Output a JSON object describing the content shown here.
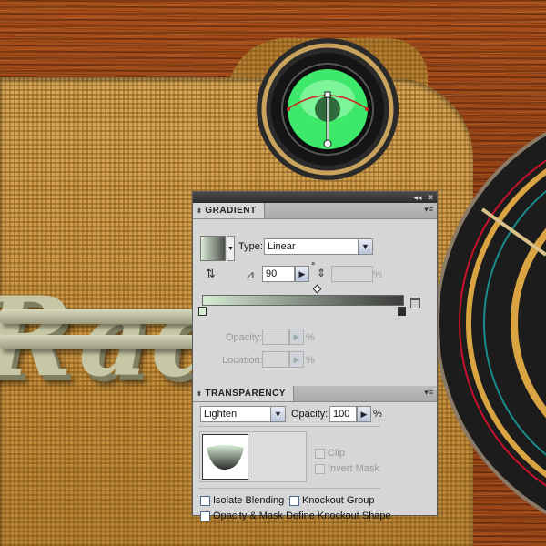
{
  "panels": {
    "dock_buttons": [
      "◂◂",
      "✕"
    ],
    "gradient": {
      "title": "GRADIENT",
      "type_label": "Type:",
      "type_value": "Linear",
      "angle_value": "90",
      "degree_symbol": "°",
      "aspect_unit": "%",
      "opacity_label": "Opacity:",
      "opacity_unit": "%",
      "location_label": "Location:",
      "location_unit": "%",
      "colors": {
        "start": "#d6ecd3",
        "end": "#2b2b2b"
      }
    },
    "transparency": {
      "title": "TRANSPARENCY",
      "blend_mode": "Lighten",
      "opacity_label": "Opacity:",
      "opacity_value": "100",
      "opacity_unit": "%",
      "clip_label": "Clip",
      "invert_mask_label": "Invert Mask",
      "isolate_blending_label": "Isolate Blending",
      "knockout_group_label": "Knockout Group",
      "opacity_mask_label": "Opacity & Mask Define Knockout Shape"
    }
  },
  "artwork": {
    "logo_text": "Rad",
    "knob_color": "#3ee86a",
    "dial_colors": [
      "#c8102e",
      "#1a8c8c",
      "#d9a441"
    ]
  }
}
